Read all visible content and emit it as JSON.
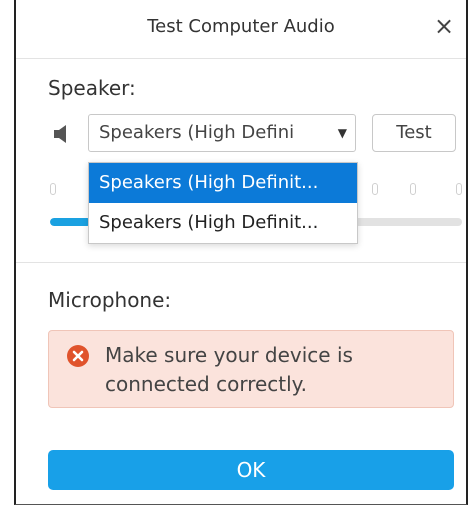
{
  "dialog": {
    "title": "Test Computer Audio",
    "close_glyph": "×"
  },
  "speaker": {
    "label": "Speaker:",
    "icon": "speaker-icon",
    "selected_device": "Speakers (High Defini",
    "test_label": "Test",
    "dropdown_options": [
      "Speakers (High Definit...",
      "Speakers (High Definit..."
    ],
    "selected_option_index": 0,
    "volume_level": 0.1
  },
  "microphone": {
    "label": "Microphone:",
    "error_icon": "error-icon",
    "error_message": "Make sure your device is connected correctly."
  },
  "ok_label": "OK",
  "colors": {
    "accent": "#18a0e8",
    "selected_option": "#0c7ad8",
    "error_background": "#fbe3dc",
    "error_icon": "#e0532c"
  }
}
